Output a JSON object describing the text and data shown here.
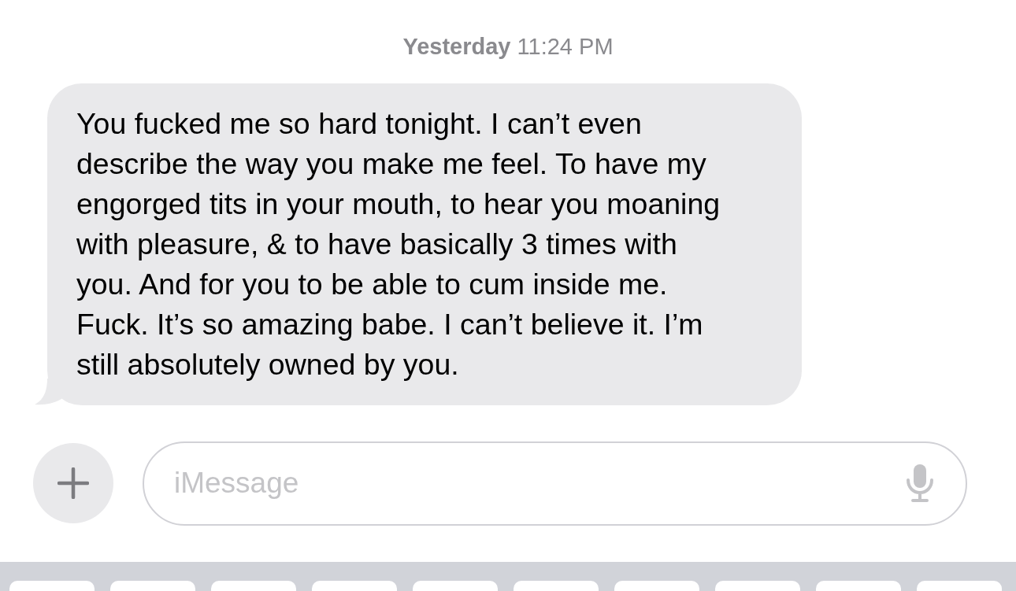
{
  "timestamp": "**Yesterday** 11:24 PM",
  "messages": [
    {
      "kind": "received",
      "text": "You fucked me so hard tonight. I can’t even describe the way you make me feel. To have my engorged tits in your mouth, to hear you moaning with pleasure, & to have basically 3 times with you. And for you to be able to cum inside me. Fuck. It’s so amazing babe. I can’t believe it. I’m still absolutely owned by you."
    }
  ],
  "composer": {
    "placeholder": "iMessage"
  }
}
